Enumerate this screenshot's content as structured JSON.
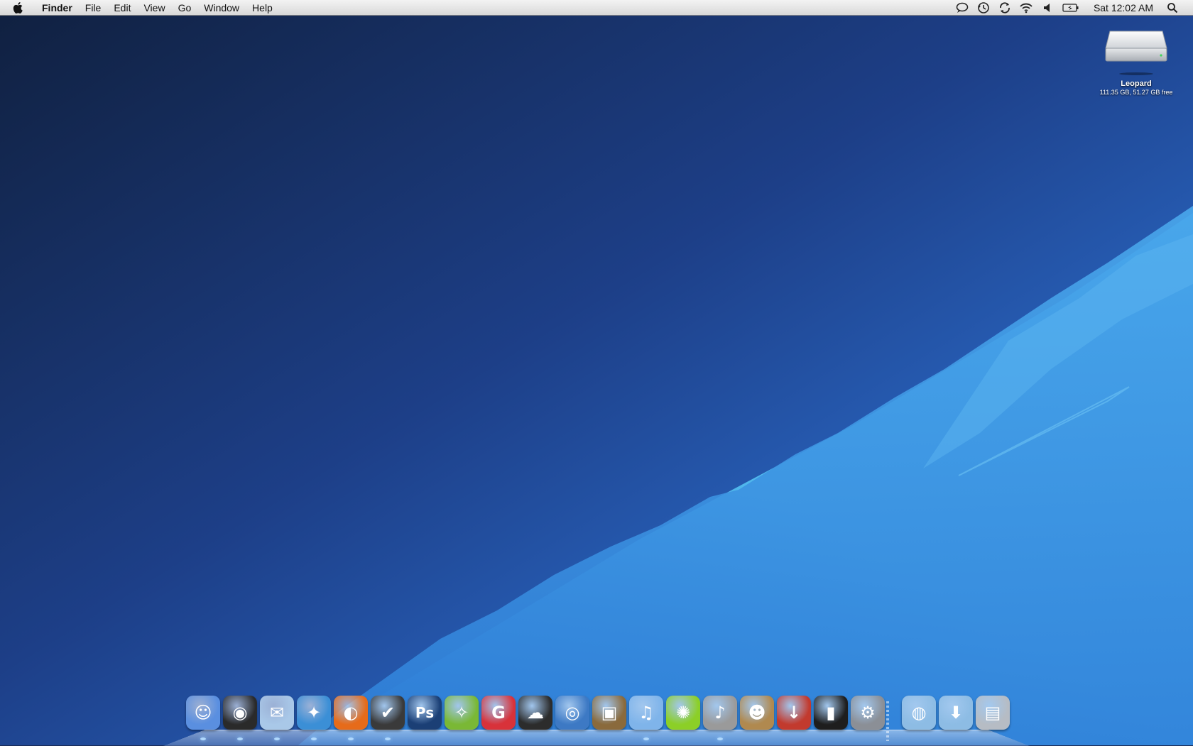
{
  "menubar": {
    "app_name": "Finder",
    "menus": [
      "File",
      "Edit",
      "View",
      "Go",
      "Window",
      "Help"
    ],
    "clock": "Sat 12:02 AM",
    "status_icons": [
      "chat-bubble-icon",
      "time-machine-icon",
      "sync-icon",
      "wifi-icon",
      "volume-icon",
      "battery-icon",
      "spotlight-icon"
    ]
  },
  "desktop": {
    "disk": {
      "name": "Leopard",
      "info": "111.35 GB, 51.27 GB free"
    }
  },
  "dock": {
    "items": [
      {
        "name": "finder-icon",
        "color": "#5a8fe0",
        "glyph": "☺"
      },
      {
        "name": "dashboard-icon",
        "color": "#2a2a2a",
        "glyph": "◉"
      },
      {
        "name": "mail-icon",
        "color": "#a9c8e8",
        "glyph": "✉"
      },
      {
        "name": "safari-icon",
        "color": "#3b8fd6",
        "glyph": "✦"
      },
      {
        "name": "firefox-icon",
        "color": "#e66b1a",
        "glyph": "◐"
      },
      {
        "name": "ichat-icon",
        "color": "#3a3a3a",
        "glyph": "✔"
      },
      {
        "name": "photoshop-icon",
        "color": "#1b3f75",
        "glyph": "Ps"
      },
      {
        "name": "raygun-icon",
        "color": "#7ab835",
        "glyph": "✧"
      },
      {
        "name": "adobe-icon",
        "color": "#d8323a",
        "glyph": "G"
      },
      {
        "name": "burn-icon",
        "color": "#2c2c2c",
        "glyph": "☁"
      },
      {
        "name": "preview-icon",
        "color": "#3d79c4",
        "glyph": "◎"
      },
      {
        "name": "iphoto-icon",
        "color": "#8a6a3c",
        "glyph": "▣"
      },
      {
        "name": "itunes-icon",
        "color": "#7fb4ea",
        "glyph": "♫"
      },
      {
        "name": "limewire-icon",
        "color": "#8ccf27",
        "glyph": "✺"
      },
      {
        "name": "microphone-icon",
        "color": "#9a9a9a",
        "glyph": "♪"
      },
      {
        "name": "cyberduck-icon",
        "color": "#b0894f",
        "glyph": "☻"
      },
      {
        "name": "transmission-icon",
        "color": "#c23a2e",
        "glyph": "↓"
      },
      {
        "name": "notebook-icon",
        "color": "#1e1e1e",
        "glyph": "▮"
      },
      {
        "name": "system-preferences-icon",
        "color": "#8b8f96",
        "glyph": "⚙"
      },
      {
        "name": "documents-folder-icon",
        "color": "#8dbce4",
        "glyph": "◍"
      },
      {
        "name": "downloads-folder-icon",
        "color": "#8dbce4",
        "glyph": "⬇"
      },
      {
        "name": "trash-icon",
        "color": "#b6bcc4",
        "glyph": "▤"
      }
    ],
    "running": [
      true,
      true,
      true,
      true,
      true,
      true,
      false,
      false,
      false,
      false,
      false,
      false,
      true,
      false,
      true,
      false,
      false,
      false,
      false,
      false,
      false,
      false
    ]
  }
}
